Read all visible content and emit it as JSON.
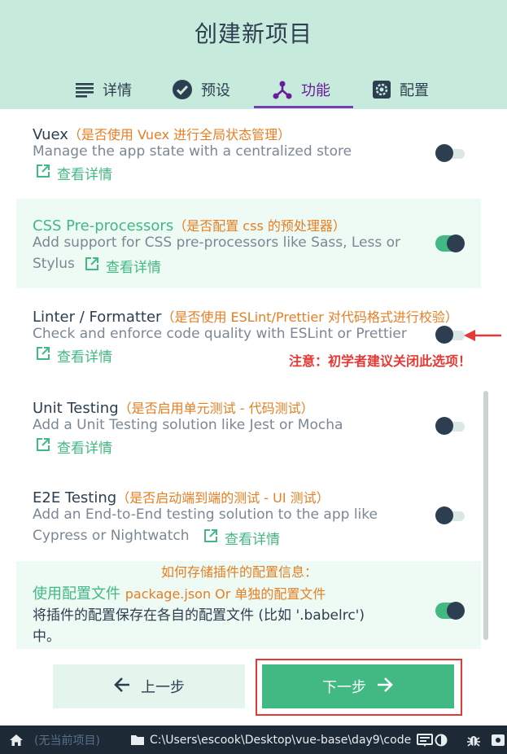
{
  "header": {
    "title": "创建新项目",
    "tabs": [
      {
        "label": "详情",
        "icon": "list-icon"
      },
      {
        "label": "预设",
        "icon": "check-circle-icon"
      },
      {
        "label": "功能",
        "icon": "branch-icon",
        "active": true
      },
      {
        "label": "配置",
        "icon": "gear-icon"
      }
    ]
  },
  "features": [
    {
      "title": "Vuex",
      "note": "（是否使用 Vuex 进行全局状态管理）",
      "desc": "Manage the app state with a centralized store",
      "link": "查看详情",
      "enabled": false
    },
    {
      "title": "CSS Pre-processors",
      "note": "（是否配置 css 的预处理器）",
      "desc_line1": "Add support for CSS pre-processors like Sass, Less or",
      "desc_line2": "Stylus",
      "link": "查看详情",
      "enabled": true
    },
    {
      "title": "Linter / Formatter",
      "note": "（是否使用 ESLint/Prettier 对代码格式进行校验）",
      "desc": "Check and enforce code quality with ESLint or Prettier",
      "link": "查看详情",
      "enabled": false
    },
    {
      "title": "Unit Testing",
      "note": "（是否启用单元测试 - 代码测试）",
      "desc": "Add a Unit Testing solution like Jest or Mocha",
      "link": "查看详情",
      "enabled": false
    },
    {
      "title": "E2E Testing",
      "note": "（是否启动端到端的测试 - UI 测试）",
      "desc_line1": "Add an End-to-End testing solution to the app like",
      "desc_line2": "Cypress or Nightwatch",
      "link": "查看详情",
      "enabled": false
    }
  ],
  "config": {
    "question": "如何存储插件的配置信息：",
    "title": "使用配置文件",
    "note": "package.json Or 单独的配置文件",
    "desc_line1": "将插件的配置保存在各自的配置文件 (比如 '.babelrc')",
    "desc_line2": "中。",
    "enabled": true
  },
  "annotation": "注意：初学者建议关闭此选项！",
  "buttons": {
    "prev": "上一步",
    "next": "下一步"
  },
  "statusbar": {
    "project": "(无当前项目)",
    "path": "C:\\Users\\escook\\Desktop\\vue-base\\day9\\code"
  },
  "colors": {
    "accent": "#42b983",
    "header_bg": "#c6eadb",
    "active_tab": "#6a1b9a",
    "note": "#e67e22",
    "warning": "#e53935",
    "statusbar": "#1d2935"
  }
}
